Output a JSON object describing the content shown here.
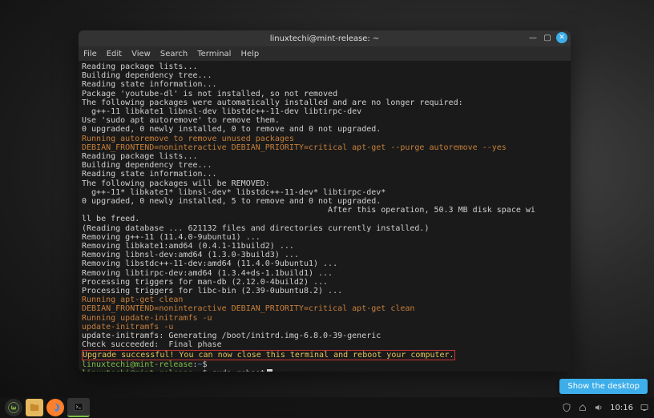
{
  "window": {
    "title": "linuxtechi@mint-release: ~",
    "menus": [
      "File",
      "Edit",
      "View",
      "Search",
      "Terminal",
      "Help"
    ]
  },
  "terminal": {
    "lines": [
      {
        "t": "Reading package lists..."
      },
      {
        "t": "Building dependency tree..."
      },
      {
        "t": "Reading state information..."
      },
      {
        "t": "Package 'youtube-dl' is not installed, so not removed"
      },
      {
        "t": "The following packages were automatically installed and are no longer required:"
      },
      {
        "t": "  g++-11 libkate1 libnsl-dev libstdc++-11-dev libtirpc-dev"
      },
      {
        "t": "Use 'sudo apt autoremove' to remove them."
      },
      {
        "t": "0 upgraded, 0 newly installed, 0 to remove and 0 not upgraded."
      },
      {
        "t": "Running autoremove to remove unused packages",
        "c": "orange"
      },
      {
        "t": "DEBIAN_FRONTEND=noninteractive DEBIAN_PRIORITY=critical apt-get --purge autoremove --yes",
        "c": "orange"
      },
      {
        "t": "Reading package lists..."
      },
      {
        "t": "Building dependency tree..."
      },
      {
        "t": "Reading state information..."
      },
      {
        "t": "The following packages will be REMOVED:"
      },
      {
        "t": "  g++-11* libkate1* libnsl-dev* libstdc++-11-dev* libtirpc-dev*"
      },
      {
        "t": "0 upgraded, 0 newly installed, 5 to remove and 0 not upgraded."
      },
      {
        "t": "                                                   After this operation, 50.3 MB disk space wi"
      },
      {
        "t": "ll be freed."
      },
      {
        "t": "(Reading database ... 621132 files and directories currently installed.)"
      },
      {
        "t": "Removing g++-11 (11.4.0-9ubuntu1) ..."
      },
      {
        "t": "Removing libkate1:amd64 (0.4.1-11build2) ..."
      },
      {
        "t": "Removing libnsl-dev:amd64 (1.3.0-3build3) ..."
      },
      {
        "t": "Removing libstdc++-11-dev:amd64 (11.4.0-9ubuntu1) ..."
      },
      {
        "t": "Removing libtirpc-dev:amd64 (1.3.4+ds-1.1build1) ..."
      },
      {
        "t": "Processing triggers for man-db (2.12.0-4build2) ..."
      },
      {
        "t": "Processing triggers for libc-bin (2.39-0ubuntu8.2) ..."
      },
      {
        "t": "Running apt-get clean",
        "c": "orange"
      },
      {
        "t": "DEBIAN_FRONTEND=noninteractive DEBIAN_PRIORITY=critical apt-get clean",
        "c": "orange"
      },
      {
        "t": "Running update-initramfs -u",
        "c": "orange"
      },
      {
        "t": "update-initramfs -u",
        "c": "orange"
      },
      {
        "t": "update-initramfs: Generating /boot/initrd.img-6.8.0-39-generic"
      },
      {
        "t": "Check succeeded:  Final phase"
      },
      {
        "t": "Upgrade successful! You can now close this terminal and reboot your computer.",
        "c": "yellow",
        "box": true
      }
    ],
    "prompt_user": "linuxtechi@mint-release",
    "prompt_path": "~",
    "prompt_sep": ":",
    "prompt_tail": "$",
    "command": "sudo reboot"
  },
  "taskbar": {
    "tooltip": "Show the desktop",
    "clock": "10:16"
  }
}
